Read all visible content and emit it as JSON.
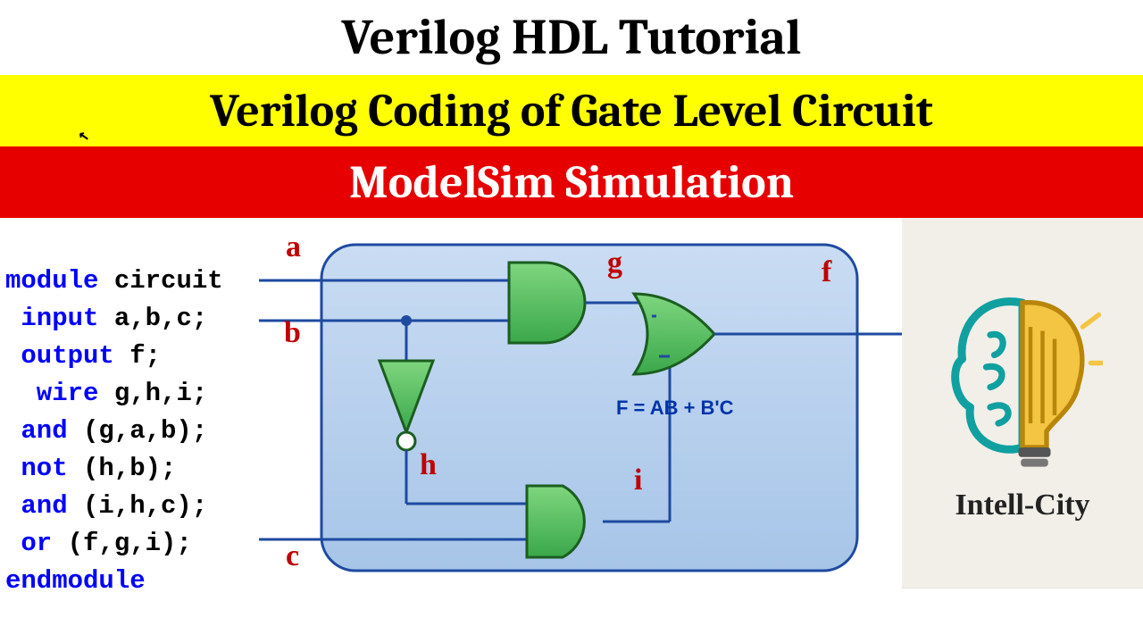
{
  "banners": {
    "b1": "Verilog HDL Tutorial",
    "b2": "Verilog Coding of Gate Level Circuit",
    "b3": "ModelSim Simulation"
  },
  "code": {
    "l1a": "module ",
    "l1b": "circuit",
    "l2a": " input ",
    "l2b": "a,b,c;",
    "l3a": " output ",
    "l3b": "f;",
    "l4a": "  wire ",
    "l4b": "g,h,i;",
    "l5a": " and ",
    "l5b": "(g,a,b);",
    "l6a": " not ",
    "l6b": "(h,b);",
    "l7a": " and ",
    "l7b": "(i,h,c);",
    "l8a": " or ",
    "l8b": "(f,g,i);",
    "l9a": "endmodule"
  },
  "signals": {
    "a": "a",
    "b": "b",
    "c": "c",
    "g": "g",
    "h": "h",
    "i": "i",
    "f": "f"
  },
  "equation": "F = AB + B'C",
  "logo_text": "Intell-City",
  "chart_data": {
    "type": "logic-diagram",
    "inputs": [
      "a",
      "b",
      "c"
    ],
    "outputs": [
      "f"
    ],
    "gates": [
      {
        "type": "and",
        "inputs": [
          "a",
          "b"
        ],
        "output": "g"
      },
      {
        "type": "not",
        "inputs": [
          "b"
        ],
        "output": "h"
      },
      {
        "type": "and",
        "inputs": [
          "h",
          "c"
        ],
        "output": "i"
      },
      {
        "type": "or",
        "inputs": [
          "g",
          "i"
        ],
        "output": "f"
      }
    ],
    "equation": "F = AB + B'C"
  }
}
